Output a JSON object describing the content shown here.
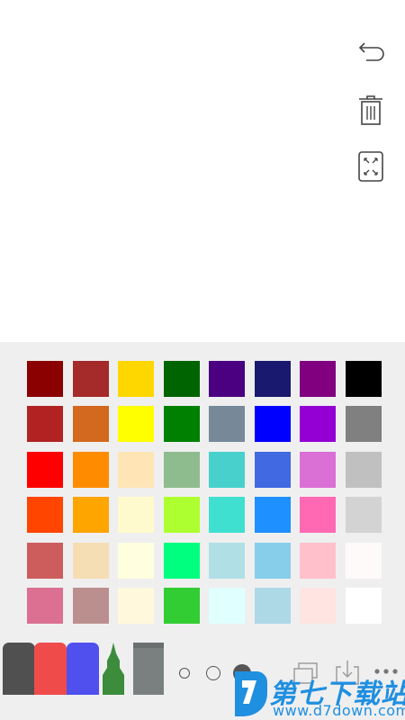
{
  "side_tools": [
    {
      "name": "undo-button",
      "icon": "undo-icon"
    },
    {
      "name": "clear-button",
      "icon": "trash-icon"
    },
    {
      "name": "fullscreen-button",
      "icon": "expand-icon"
    }
  ],
  "palette": {
    "rows": [
      [
        "#8b0000",
        "#a52a2a",
        "#ffd700",
        "#006400",
        "#4b0082",
        "#191970",
        "#800080",
        "#000000"
      ],
      [
        "#b22222",
        "#d2691e",
        "#ffff00",
        "#008000",
        "#778899",
        "#0000ff",
        "#9400d3",
        "#808080"
      ],
      [
        "#ff0000",
        "#ff8c00",
        "#ffe4b5",
        "#8fbc8f",
        "#48d1cc",
        "#4169e1",
        "#da70d6",
        "#c0c0c0"
      ],
      [
        "#ff4500",
        "#ffa500",
        "#fffacd",
        "#adff2f",
        "#40e0d0",
        "#1e90ff",
        "#ff69b4",
        "#d3d3d3"
      ],
      [
        "#cd5c5c",
        "#f5deb3",
        "#ffffe0",
        "#00ff7f",
        "#b0e0e6",
        "#87ceeb",
        "#ffc0cb",
        "#fffafa"
      ],
      [
        "#db7093",
        "#bc8f8f",
        "#fff8dc",
        "#32cd32",
        "#e0ffff",
        "#add8e6",
        "#ffe4e1",
        "#ffffff"
      ]
    ]
  },
  "pens": [
    {
      "name": "marker-dark",
      "color": "#505050"
    },
    {
      "name": "marker-red",
      "color": "#ef4b4b"
    },
    {
      "name": "marker-blue",
      "color": "#5050ef"
    },
    {
      "name": "pencil-green",
      "color": "#3c8c3c"
    },
    {
      "name": "eraser",
      "color": "#7a8080"
    }
  ],
  "right_tools": [
    {
      "name": "layers-button",
      "icon": "layers-icon"
    },
    {
      "name": "save-button",
      "icon": "download-icon"
    },
    {
      "name": "more-button",
      "icon": "ellipsis-icon"
    }
  ],
  "watermark": {
    "cn": "第七下载站",
    "url": "www.d7down.com"
  }
}
